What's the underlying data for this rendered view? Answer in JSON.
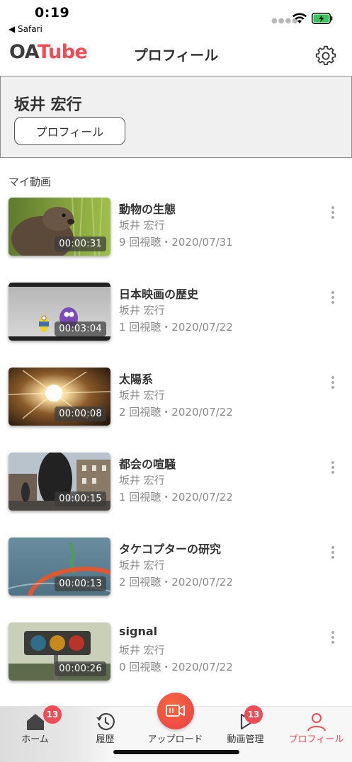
{
  "status_bar": {
    "time": "0:19",
    "back_label": "◀ Safari"
  },
  "header": {
    "logo_oa": "OA",
    "logo_tube": "Tube",
    "title": "プロフィール"
  },
  "profile": {
    "name": "坂井 宏行",
    "button_label": "プロフィール"
  },
  "section": {
    "title": "マイ動画"
  },
  "videos": [
    {
      "title": "動物の生態",
      "author": "坂井 宏行",
      "meta": "9 回視聴・2020/07/31",
      "duration": "00:00:31",
      "thumb": "animal"
    },
    {
      "title": "日本映画の歴史",
      "author": "坂井 宏行",
      "meta": "1 回視聴・2020/07/22",
      "duration": "00:03:04",
      "thumb": "minion"
    },
    {
      "title": "太陽系",
      "author": "坂井 宏行",
      "meta": "2 回視聴・2020/07/22",
      "duration": "00:00:08",
      "thumb": "sun"
    },
    {
      "title": "都会の喧騒",
      "author": "坂井 宏行",
      "meta": "1 回視聴・2020/07/22",
      "duration": "00:00:15",
      "thumb": "city"
    },
    {
      "title": "タケコプターの研究",
      "author": "坂井 宏行",
      "meta": "2 回視聴・2020/07/22",
      "duration": "00:00:13",
      "thumb": "propeller"
    },
    {
      "title": "signal",
      "author": "坂井 宏行",
      "meta": "0 回視聴・2020/07/22",
      "duration": "00:00:26",
      "thumb": "signal"
    }
  ],
  "tabs": [
    {
      "label": "ホーム",
      "icon": "home-icon",
      "badge": "13"
    },
    {
      "label": "履歴",
      "icon": "history-icon",
      "badge": ""
    },
    {
      "label": "アップロード",
      "icon": "upload-video-icon",
      "badge": ""
    },
    {
      "label": "動画管理",
      "icon": "video-manage-icon",
      "badge": "13"
    },
    {
      "label": "プロフィール",
      "icon": "profile-icon",
      "badge": ""
    }
  ],
  "colors": {
    "accent": "#ef4c55",
    "profile_card_bg": "#f0f0f0",
    "text": "#333333",
    "muted": "#8a8a8a"
  }
}
